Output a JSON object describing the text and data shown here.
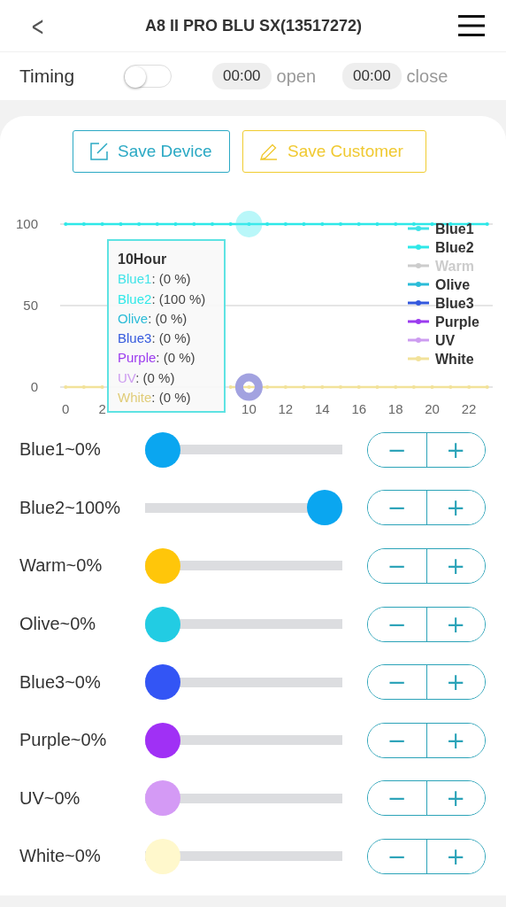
{
  "header": {
    "back": "<",
    "title": "A8 II PRO BLU SX(13517272)"
  },
  "timing": {
    "label": "Timing",
    "on": false,
    "open_time": "00:00",
    "open_label": "open",
    "close_time": "00:00",
    "close_label": "close"
  },
  "buttons": [
    {
      "kind": "device",
      "label": "Save Device"
    },
    {
      "kind": "customer",
      "label": "Save Customer"
    }
  ],
  "chart": {
    "chart_data": {
      "type": "line",
      "x": [
        0,
        1,
        2,
        3,
        4,
        5,
        6,
        7,
        8,
        9,
        10,
        11,
        12,
        13,
        14,
        15,
        16,
        17,
        18,
        19,
        20,
        21,
        22,
        23
      ],
      "xticks": [
        0,
        2,
        10,
        12,
        14,
        16,
        18,
        20,
        22
      ],
      "yticks": [
        0,
        50,
        100
      ],
      "ylim": [
        0,
        100
      ],
      "xlim": [
        -0.3,
        23.3
      ],
      "legend": "right",
      "series": [
        {
          "name": "Blue1",
          "color": "#3ee3e8",
          "values": [
            null,
            null,
            null,
            null,
            null,
            null,
            null,
            null,
            null,
            null,
            null,
            null,
            null,
            null,
            null,
            null,
            null,
            null,
            null,
            null,
            null,
            null,
            null,
            null
          ]
        },
        {
          "name": "Blue2",
          "color": "#2ee8e8",
          "values": [
            100,
            100,
            100,
            100,
            100,
            100,
            100,
            100,
            100,
            100,
            100,
            100,
            100,
            100,
            100,
            100,
            100,
            100,
            100,
            100,
            100,
            100,
            100,
            100
          ]
        },
        {
          "name": "Warm",
          "color": "#cccccc",
          "values": [
            null,
            null,
            null,
            null,
            null,
            null,
            null,
            null,
            null,
            null,
            null,
            null,
            null,
            null,
            null,
            null,
            null,
            null,
            null,
            null,
            null,
            null,
            null,
            null
          ]
        },
        {
          "name": "Olive",
          "color": "#2bbcd8",
          "values": [
            null,
            null,
            null,
            null,
            null,
            null,
            null,
            null,
            null,
            null,
            null,
            null,
            null,
            null,
            null,
            null,
            null,
            null,
            null,
            null,
            null,
            null,
            null,
            null
          ]
        },
        {
          "name": "Blue3",
          "color": "#3358dd",
          "values": [
            null,
            null,
            null,
            null,
            null,
            null,
            null,
            null,
            null,
            null,
            null,
            null,
            null,
            null,
            null,
            null,
            null,
            null,
            null,
            null,
            null,
            null,
            null,
            null
          ]
        },
        {
          "name": "Purple",
          "color": "#9b3bef",
          "values": [
            null,
            null,
            null,
            null,
            null,
            null,
            null,
            null,
            null,
            null,
            null,
            null,
            null,
            null,
            null,
            null,
            null,
            null,
            null,
            null,
            null,
            null,
            null,
            null
          ]
        },
        {
          "name": "UV",
          "color": "#cd9cf0",
          "values": [
            null,
            null,
            null,
            null,
            null,
            null,
            null,
            null,
            null,
            null,
            null,
            null,
            null,
            null,
            null,
            null,
            null,
            null,
            null,
            null,
            null,
            null,
            null,
            null
          ]
        },
        {
          "name": "White",
          "color": "#f2e29a",
          "values": [
            0,
            0,
            0,
            null,
            null,
            null,
            null,
            null,
            null,
            0,
            0,
            0,
            0,
            0,
            0,
            0,
            0,
            0,
            0,
            0,
            0,
            0,
            0,
            0
          ]
        }
      ],
      "annotations": [
        "10Hour"
      ]
    },
    "legend_states": [
      {
        "hidden": false
      },
      {
        "hidden": false
      },
      {
        "hidden": true
      },
      {
        "hidden": false
      },
      {
        "hidden": false
      },
      {
        "hidden": false
      },
      {
        "hidden": false
      },
      {
        "hidden": false
      }
    ],
    "tooltip": {
      "rows": [
        {
          "name": "Blue1",
          "value": ": (0 %)",
          "color": "#3ee3e8"
        },
        {
          "name": "Blue2",
          "value": ": (100 %)",
          "color": "#2ee8e8"
        },
        {
          "name": "Olive",
          "value": ": (0 %)",
          "color": "#2bbcd8"
        },
        {
          "name": "Blue3",
          "value": ": (0 %)",
          "color": "#3358dd"
        },
        {
          "name": "Purple",
          "value": ": (0 %)",
          "color": "#9b3bef"
        },
        {
          "name": "UV",
          "value": ": (0 %)",
          "color": "#cd9cf0"
        },
        {
          "name": "White",
          "value": ": (0 %)",
          "color": "#e0cc78"
        }
      ]
    }
  },
  "channels": [
    {
      "label": "Blue1~0%",
      "level": 0,
      "color": "#0aa6f0",
      "minus": "−",
      "plus": "+"
    },
    {
      "label": "Blue2~100%",
      "level": 1,
      "color": "#0aa6f0",
      "minus": "−",
      "plus": "+"
    },
    {
      "label": "Warm~0%",
      "level": 0,
      "color": "#ffc60a",
      "minus": "−",
      "plus": "+"
    },
    {
      "label": "Olive~0%",
      "level": 0,
      "color": "#22cce3",
      "minus": "−",
      "plus": "+"
    },
    {
      "label": "Blue3~0%",
      "level": 0,
      "color": "#3355f5",
      "minus": "−",
      "plus": "+"
    },
    {
      "label": "Purple~0%",
      "level": 0,
      "color": "#a030f5",
      "minus": "−",
      "plus": "+"
    },
    {
      "label": "UV~0%",
      "level": 0,
      "color": "#d49af5",
      "minus": "−",
      "plus": "+"
    },
    {
      "label": "White~0%",
      "level": 0,
      "color": "#fff8cc",
      "minus": "−",
      "plus": "+"
    }
  ]
}
